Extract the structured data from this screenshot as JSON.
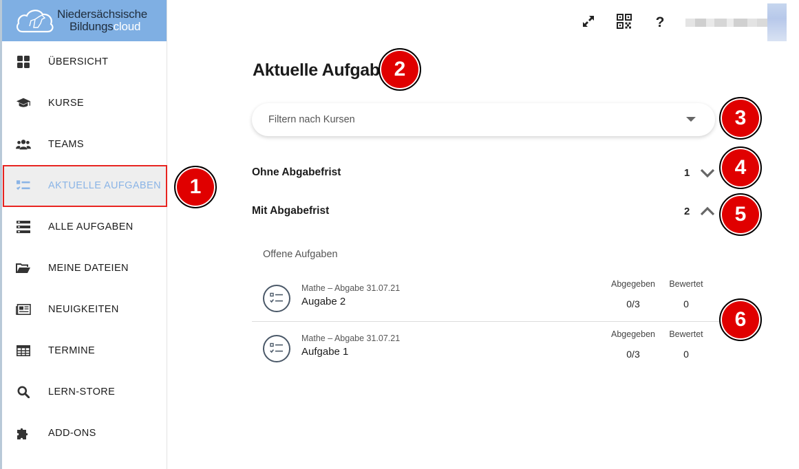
{
  "brand": {
    "line1": "Niedersächsische",
    "line2_main": "Bildungs",
    "line2_thin": "cloud"
  },
  "sidebar": {
    "items": [
      {
        "label": "ÜBERSICHT",
        "icon": "dashboard-icon"
      },
      {
        "label": "KURSE",
        "icon": "graduation-cap-icon"
      },
      {
        "label": "TEAMS",
        "icon": "users-icon"
      },
      {
        "label": "AKTUELLE AUFGABEN",
        "icon": "task-list-icon",
        "active": true
      },
      {
        "label": "ALLE AUFGABEN",
        "icon": "tasks-stack-icon"
      },
      {
        "label": "MEINE DATEIEN",
        "icon": "folder-open-icon"
      },
      {
        "label": "NEUIGKEITEN",
        "icon": "newspaper-icon"
      },
      {
        "label": "TERMINE",
        "icon": "calendar-grid-icon"
      },
      {
        "label": "LERN-STORE",
        "icon": "search-icon"
      },
      {
        "label": "ADD-ONS",
        "icon": "puzzle-icon"
      }
    ]
  },
  "toolbar": {
    "icons": [
      "fullscreen-icon",
      "qr-code-icon",
      "help-icon"
    ],
    "help_label": "?"
  },
  "main": {
    "title": "Aktuelle Aufgaben",
    "filter_placeholder": "Filtern nach Kursen",
    "sections": [
      {
        "title": "Ohne Abgabefrist",
        "count": "1",
        "expanded": false
      },
      {
        "title": "Mit Abgabefrist",
        "count": "2",
        "expanded": true
      }
    ],
    "subheader": "Offene Aufgaben",
    "tasks": [
      {
        "meta": "Mathe – Abgabe 31.07.21",
        "name": "Augabe 2",
        "submitted_label": "Abgegeben",
        "submitted": "0/3",
        "graded_label": "Bewertet",
        "graded": "0"
      },
      {
        "meta": "Mathe – Abgabe 31.07.21",
        "name": "Aufgabe 1",
        "submitted_label": "Abgegeben",
        "submitted": "0/3",
        "graded_label": "Bewertet",
        "graded": "0"
      }
    ]
  },
  "markers": [
    "1",
    "2",
    "3",
    "4",
    "5",
    "6"
  ],
  "colors": {
    "brand_blue": "#7fafe3",
    "active_text": "#8ab4e6",
    "highlight_border": "#e8231f",
    "marker_red": "#e00000"
  }
}
